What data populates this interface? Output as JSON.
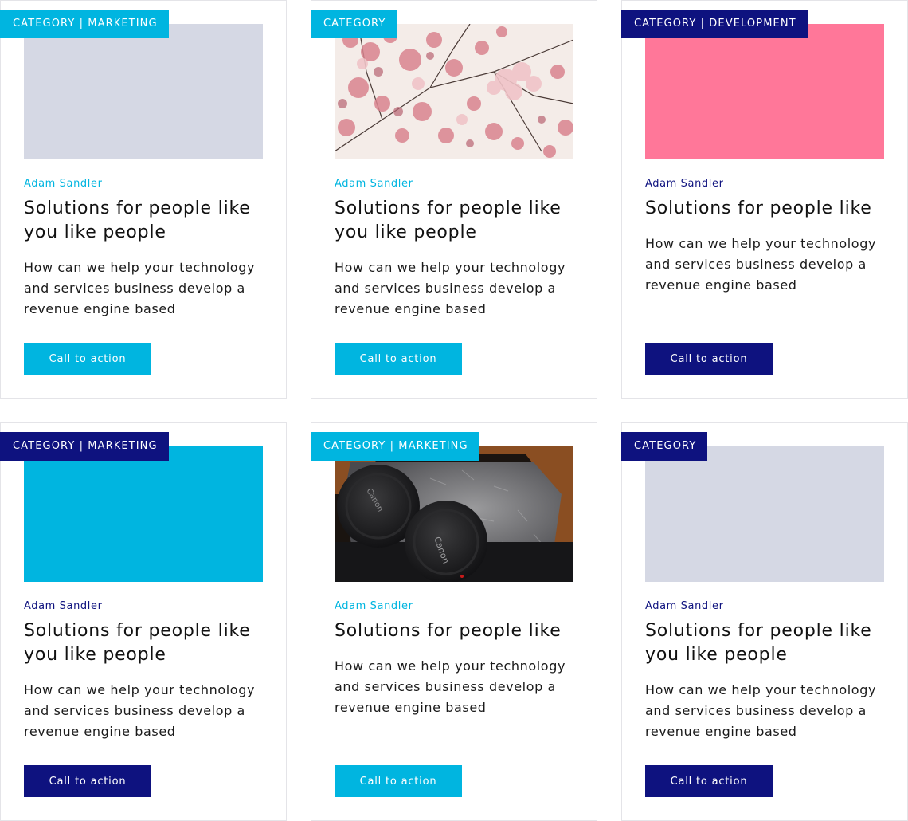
{
  "colors": {
    "cyan": "#00b5e0",
    "navy": "#0e127f",
    "placeholder_gray": "#d5d8e4",
    "placeholder_pink": "#ff7799",
    "placeholder_cyan": "#00b5e0"
  },
  "cards": [
    {
      "badge": "CATEGORY | MARKETING",
      "author": "Adam Sandler",
      "title": "Solutions for people like you like people",
      "description": "How can we help your technology and services business develop a revenue engine based",
      "cta": "Call to action",
      "image": "gray-placeholder",
      "accent": "cyan"
    },
    {
      "badge": "CATEGORY",
      "author": "Adam Sandler",
      "title": "Solutions for people like you like people",
      "description": "How can we help your technology and services business develop a revenue engine based",
      "cta": "Call to action",
      "image": "cherry-blossom-photo",
      "accent": "cyan"
    },
    {
      "badge": "CATEGORY | DEVELOPMENT",
      "author": "Adam Sandler",
      "title": "Solutions for people like",
      "description": "How can we help your technology and services business develop a revenue engine based",
      "cta": "Call to action",
      "image": "pink-placeholder",
      "accent": "navy"
    },
    {
      "badge": "CATEGORY | MARKETING",
      "author": "Adam Sandler",
      "title": "Solutions for people like you like people",
      "description": "How can we help your technology and services business develop a revenue engine based",
      "cta": "Call to action",
      "image": "cyan-placeholder",
      "accent": "navy"
    },
    {
      "badge": "CATEGORY | MARKETING",
      "author": "Adam Sandler",
      "title": "Solutions for people like",
      "description": "How can we help your technology and services business develop a revenue engine based",
      "cta": "Call to action",
      "image": "camera-lens-photo",
      "accent": "cyan"
    },
    {
      "badge": "CATEGORY",
      "author": "Adam Sandler",
      "title": "Solutions for people like you like people",
      "description": "How can we help your technology and services business develop a revenue engine based",
      "cta": "Call to action",
      "image": "gray-placeholder",
      "accent": "navy"
    }
  ]
}
